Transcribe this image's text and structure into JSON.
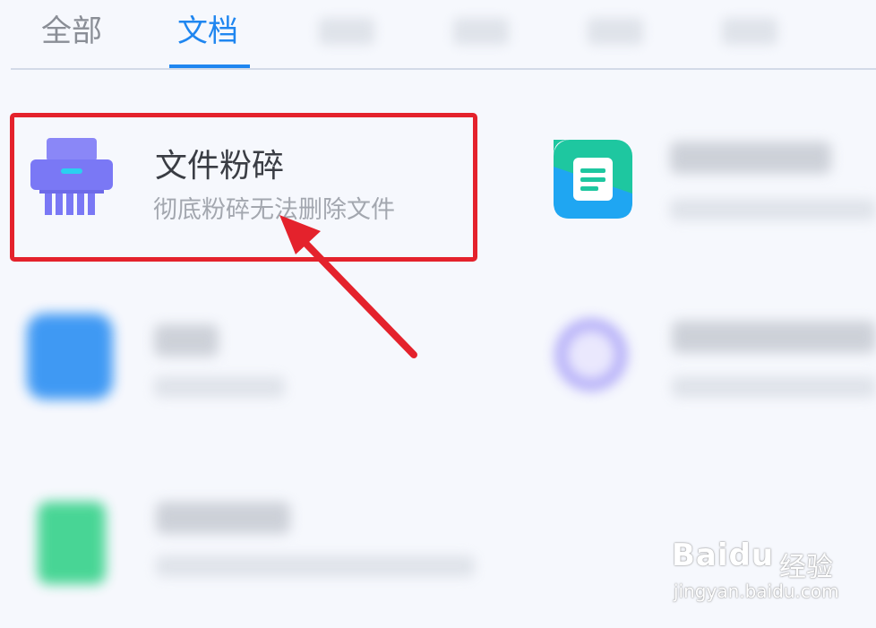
{
  "tabs": {
    "all_label": "全部",
    "doc_label": "文档"
  },
  "apps": {
    "shredder": {
      "title": "文件粉碎",
      "subtitle": "彻底粉碎无法删除文件",
      "icon": "shredder-icon"
    }
  },
  "watermark": {
    "logo": "Baidu",
    "suffix": "经验",
    "url": "jingyan.baidu.com"
  },
  "colors": {
    "accent": "#1f86f0",
    "highlight": "#e4222c",
    "shredder_icon": "#7a78f5",
    "background": "#f6f8fd"
  }
}
